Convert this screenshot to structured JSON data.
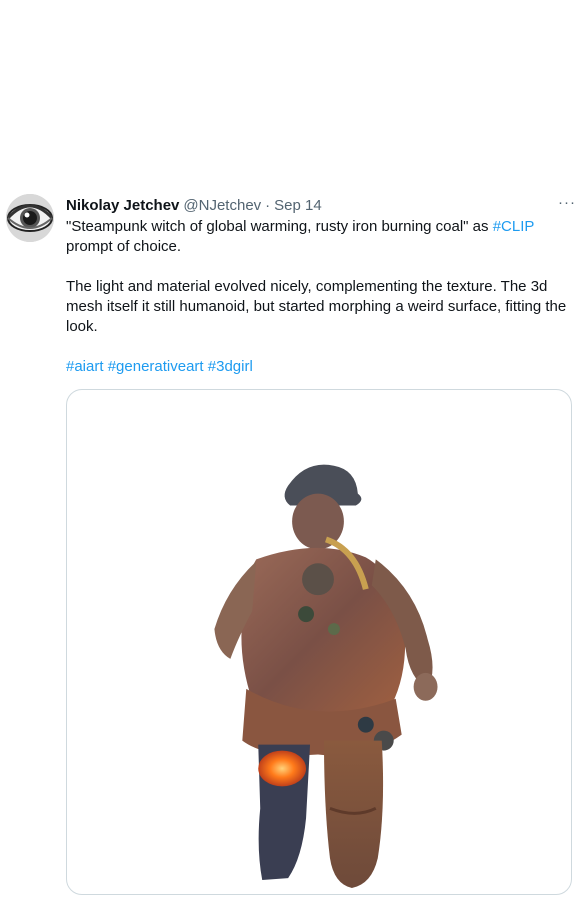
{
  "tweet": {
    "author": {
      "display_name": "Nikolay Jetchev",
      "handle": "@NJetchev",
      "avatar_icon": "eye-avatar"
    },
    "separator": "·",
    "date": "Sep 14",
    "more_icon": "more-horizontal-icon",
    "more_label": "···",
    "text": {
      "line1_before": "\"Steampunk witch of global warming, rusty iron burning coal\" as ",
      "line1_link": "#CLIP",
      "line1_after": " prompt of choice.",
      "paragraph2": "The light and material evolved nicely, complementing the texture. The 3d mesh itself it still humanoid, but started morphing a weird surface, fitting the look.",
      "hashtags": [
        "#aiart",
        "#generativeart",
        "#3dgirl"
      ]
    },
    "media": {
      "icon": "steampunk-3d-figure-image"
    }
  },
  "colors": {
    "text": "#0f1419",
    "secondary": "#536471",
    "link": "#1d9bf0",
    "border": "#cfd9de"
  }
}
